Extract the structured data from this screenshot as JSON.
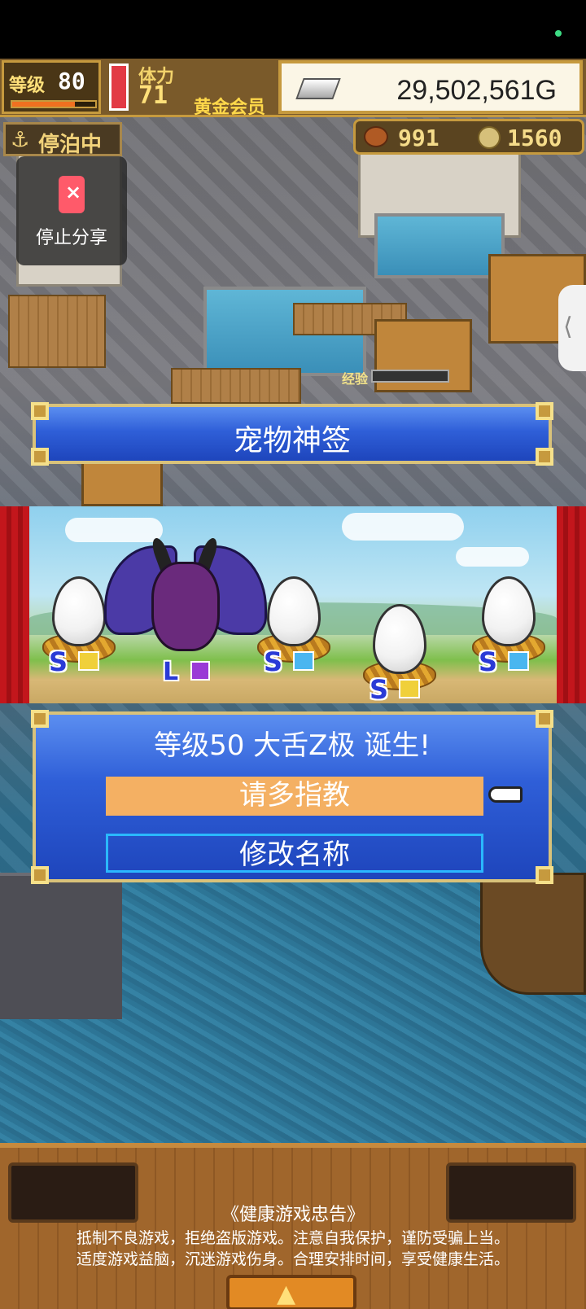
{
  "hud": {
    "level_label": "等级",
    "level_value": "80",
    "level_progress_pct": 75,
    "stamina_label": "体力",
    "stamina_value": "71",
    "member_badge": "黄金会员",
    "gold_value": "29,502,561G",
    "anchor_label": "停泊中",
    "food_value": "991",
    "medal_value": "1560"
  },
  "overlay": {
    "share_label": "停止分享"
  },
  "world": {
    "exp_label": "经验"
  },
  "title_banner": {
    "title": "宠物神签"
  },
  "stage": {
    "eggs": [
      {
        "rank": "S",
        "element": "thunder"
      },
      {
        "rank": "S",
        "element": "water"
      },
      {
        "rank": "S",
        "element": "thunder"
      },
      {
        "rank": "S",
        "element": "water"
      }
    ],
    "monster": {
      "rank": "L",
      "element": "dark"
    }
  },
  "dialog": {
    "message": "等级50 大舌Z极 诞生!",
    "option_confirm": "请多指教",
    "option_rename": "修改名称"
  },
  "footer": {
    "advisory_title": "《健康游戏忠告》",
    "advisory_line1": "抵制不良游戏，拒绝盗版游戏。注意自我保护，谨防受骗上当。",
    "advisory_line2": "适度游戏益脑，沉迷游戏伤身。合理安排时间，享受健康生活。"
  },
  "colors": {
    "dialog_blue": "#2f5fd8",
    "selected_option": "#f4b063",
    "gold_frame": "#d9c27a",
    "curtain_red": "#c3161c"
  }
}
